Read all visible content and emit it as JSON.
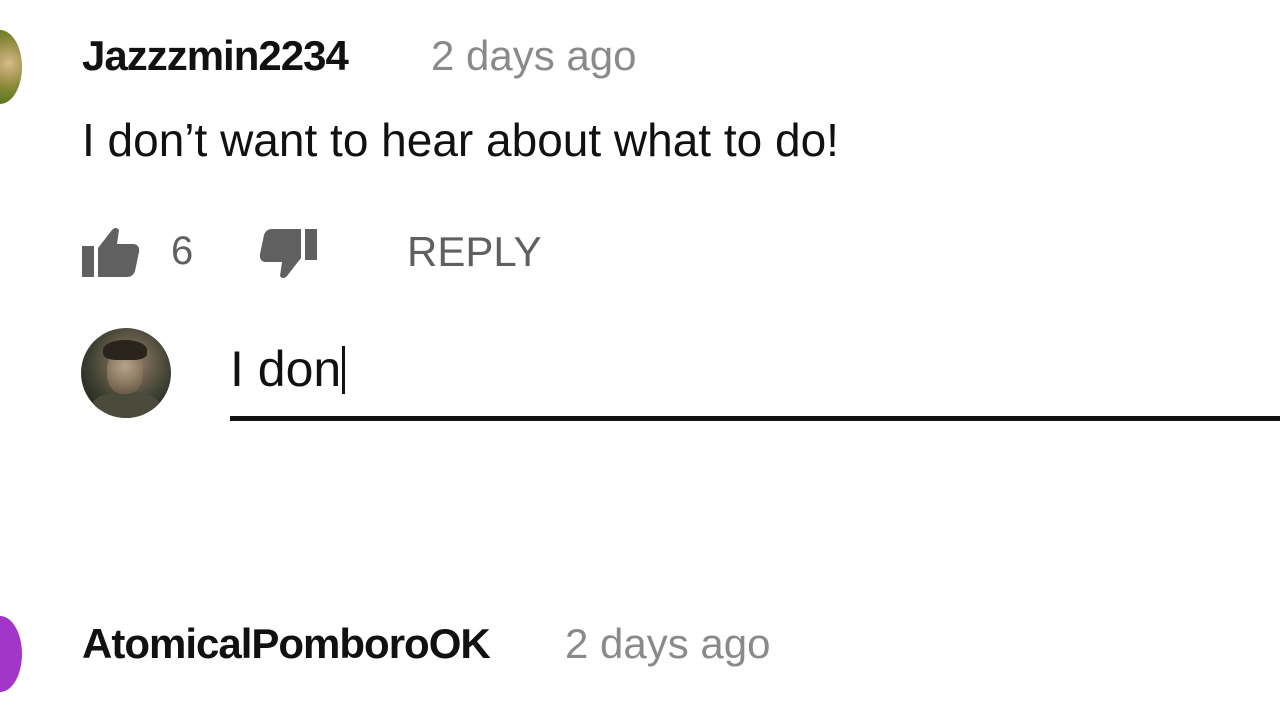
{
  "comments": [
    {
      "author": "Jazzzmin2234",
      "time": "2 days ago",
      "text": "I don’t want to hear about what to do!",
      "likes": "6",
      "reply_label": "REPLY",
      "icons": [
        "thumbs-up-icon",
        "thumbs-down-icon"
      ]
    },
    {
      "author": "AtomicalPomboroOK",
      "time": "2 days ago"
    }
  ],
  "reply_box": {
    "value": "I don"
  },
  "colors": {
    "text": "#111111",
    "muted": "#8a8a8a",
    "action": "#606060",
    "avatar_purple": "#a335c9"
  }
}
